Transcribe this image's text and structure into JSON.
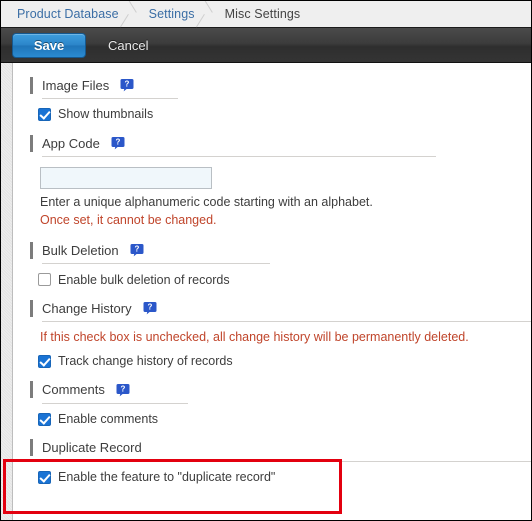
{
  "breadcrumb": {
    "items": [
      {
        "label": "Product Database",
        "current": false
      },
      {
        "label": "Settings",
        "current": false
      },
      {
        "label": "Misc Settings",
        "current": true
      }
    ]
  },
  "toolbar": {
    "save_label": "Save",
    "cancel_label": "Cancel",
    "save_color": "#2a84c8"
  },
  "sections": {
    "image_files": {
      "title": "Image Files",
      "help_icon": "help-question-icon",
      "checkbox": {
        "label": "Show thumbnails",
        "checked": true
      }
    },
    "app_code": {
      "title": "App Code",
      "help_icon": "help-question-icon",
      "input_value": "",
      "input_placeholder": "",
      "hint": "Enter a unique alphanumeric code starting with an alphabet.",
      "hint_warning": "Once set, it cannot be changed."
    },
    "bulk_deletion": {
      "title": "Bulk Deletion",
      "help_icon": "help-question-icon",
      "checkbox": {
        "label": "Enable bulk deletion of records",
        "checked": false
      }
    },
    "change_history": {
      "title": "Change History",
      "help_icon": "help-question-icon",
      "notice": "If this check box is unchecked, all change history will be permanently deleted.",
      "checkbox": {
        "label": "Track change history of records",
        "checked": true
      }
    },
    "comments": {
      "title": "Comments",
      "help_icon": "help-question-icon",
      "checkbox": {
        "label": "Enable comments",
        "checked": true
      }
    },
    "duplicate_record": {
      "title": "Duplicate Record",
      "checkbox": {
        "label": "Enable the feature to \"duplicate record\"",
        "checked": true
      },
      "highlight_color": "#e3000f"
    }
  }
}
